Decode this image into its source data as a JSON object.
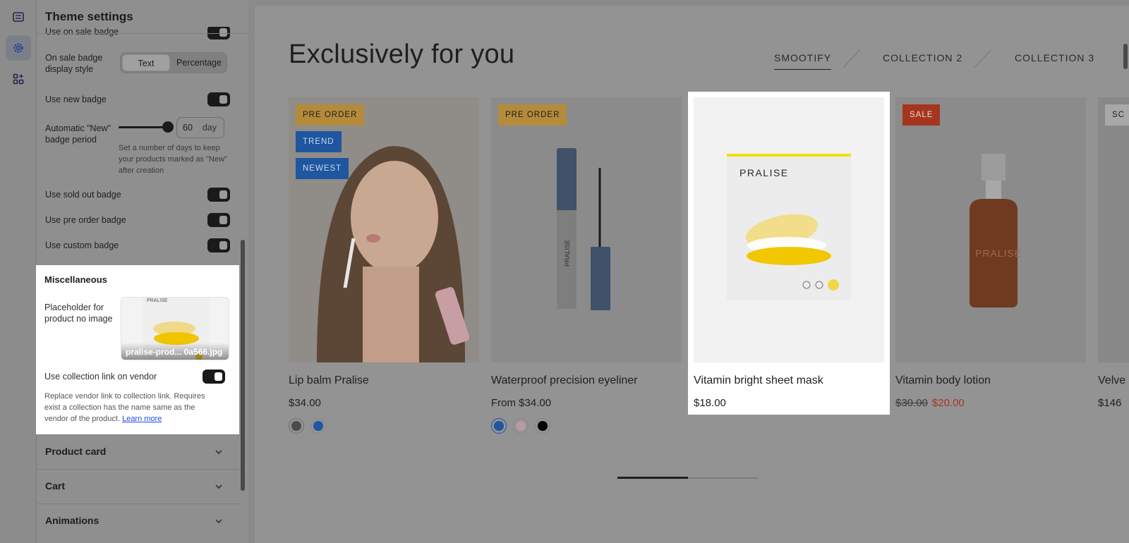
{
  "panel": {
    "title": "Theme settings",
    "cut_row_label": "Use on sale badge",
    "sale_style_label": "On sale badge display style",
    "sale_style_options": [
      "Text",
      "Percentage"
    ],
    "sale_style_selected": "Text",
    "new_badge_label": "Use new badge",
    "auto_new_label": "Automatic \"New\" badge period",
    "auto_new_value": "60",
    "auto_new_unit": "day",
    "auto_new_help": "Set a number of days to keep your products marked as \"New\" after creation",
    "sold_out_label": "Use sold out badge",
    "pre_order_label": "Use pre order badge",
    "custom_badge_label": "Use custom badge",
    "misc": {
      "title": "Miscellaneous",
      "placeholder_label": "Placeholder for product no image",
      "placeholder_file": "pralise-prod... 0a566.jpg",
      "placeholder_brand": "PRALISE",
      "vendor_link_label": "Use collection link on vendor",
      "vendor_help": "Replace vendor link to collection link. Requires exist a collection has the name same as the vendor of the product.",
      "learn_more": "Learn more"
    },
    "accordions": [
      "Product card",
      "Cart",
      "Animations"
    ]
  },
  "preview": {
    "heading": "Exclusively for you",
    "tabs": [
      "SMOOTIFY",
      "COLLECTION 2",
      "COLLECTION 3"
    ],
    "active_tab": "SMOOTIFY",
    "products": [
      {
        "name": "Lip balm Pralise",
        "price": "$34.00",
        "badges": [
          "PRE ORDER",
          "TREND",
          "NEWEST"
        ],
        "swatches": [
          "#4a4a4a",
          "#1e56a0"
        ]
      },
      {
        "name": "Waterproof precision eyeliner",
        "price": "From $34.00",
        "badges": [
          "PRE ORDER"
        ],
        "swatches": [
          "#1e56a0",
          "#b99aa2",
          "#000000"
        ],
        "brand": "PRALISE"
      },
      {
        "name": "Vitamin bright sheet mask",
        "price": "$18.00",
        "badges": [],
        "brand": "PRALISE"
      },
      {
        "name": "Vitamin body lotion",
        "price_old": "$30.00",
        "price_sale": "$20.00",
        "badges": [
          "SALE"
        ],
        "brand": "PRALISE"
      },
      {
        "name": "Velve",
        "price": "$146",
        "badges": [
          "SC"
        ]
      }
    ],
    "carousel_progress": 0.5
  }
}
